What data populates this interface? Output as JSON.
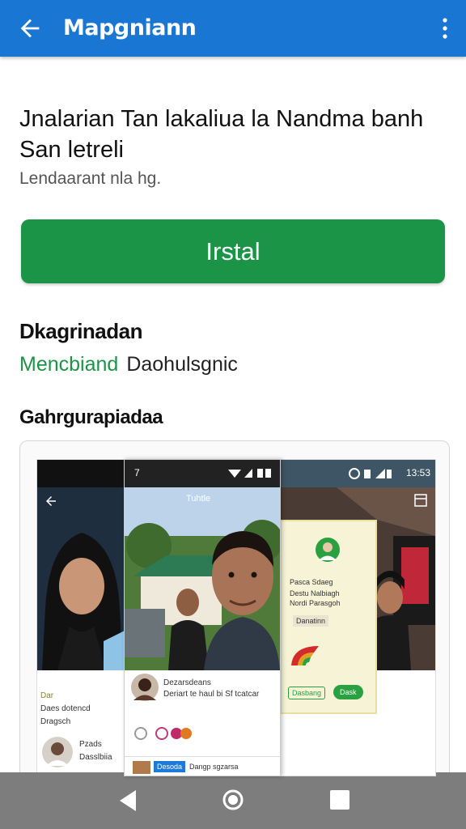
{
  "appbar": {
    "title": "Mapgniann",
    "color": "#1976d2",
    "back_icon": "arrow-left-icon",
    "menu_icon": "more-vert-icon"
  },
  "app": {
    "headline": "Jnalarian Tan lakaliua la Nandma banh San letreli",
    "subtitle": "Lendaarant nla hg.",
    "install_label": "Irstal",
    "install_color": "#1b9447"
  },
  "details": {
    "section_title": "Dkagrinadan",
    "developer": "Mencbiand",
    "category": "Daohulsgnic"
  },
  "gallery": {
    "title": "Gahrgurapiadaa",
    "shot1": {
      "line1": "Dar",
      "line2": "Daes dotencd",
      "line3": "Dragsch",
      "user": "Pzads",
      "user_sub": "Dasslbiia"
    },
    "shot2": {
      "status_left": "7",
      "app_header": "Tuhtle",
      "comment_title": "Dezarsdeans",
      "comment_body": "Deriart te haul bi Sf tcatcar",
      "chip": "Desoda",
      "chip_text": "Dangp sgzarsa"
    },
    "shot3": {
      "status_right": "13:53",
      "card_title": "Pasca Sdaeg",
      "card_line2": "Destu Nalbiagh",
      "card_line3": "Nordi Parasgoh",
      "card_line4": "Danatinn",
      "btn1": "Dasbang",
      "btn2": "Dask"
    }
  },
  "navbar": {
    "back_icon": "nav-back-icon",
    "home_icon": "nav-home-icon",
    "recents_icon": "nav-recents-icon"
  }
}
